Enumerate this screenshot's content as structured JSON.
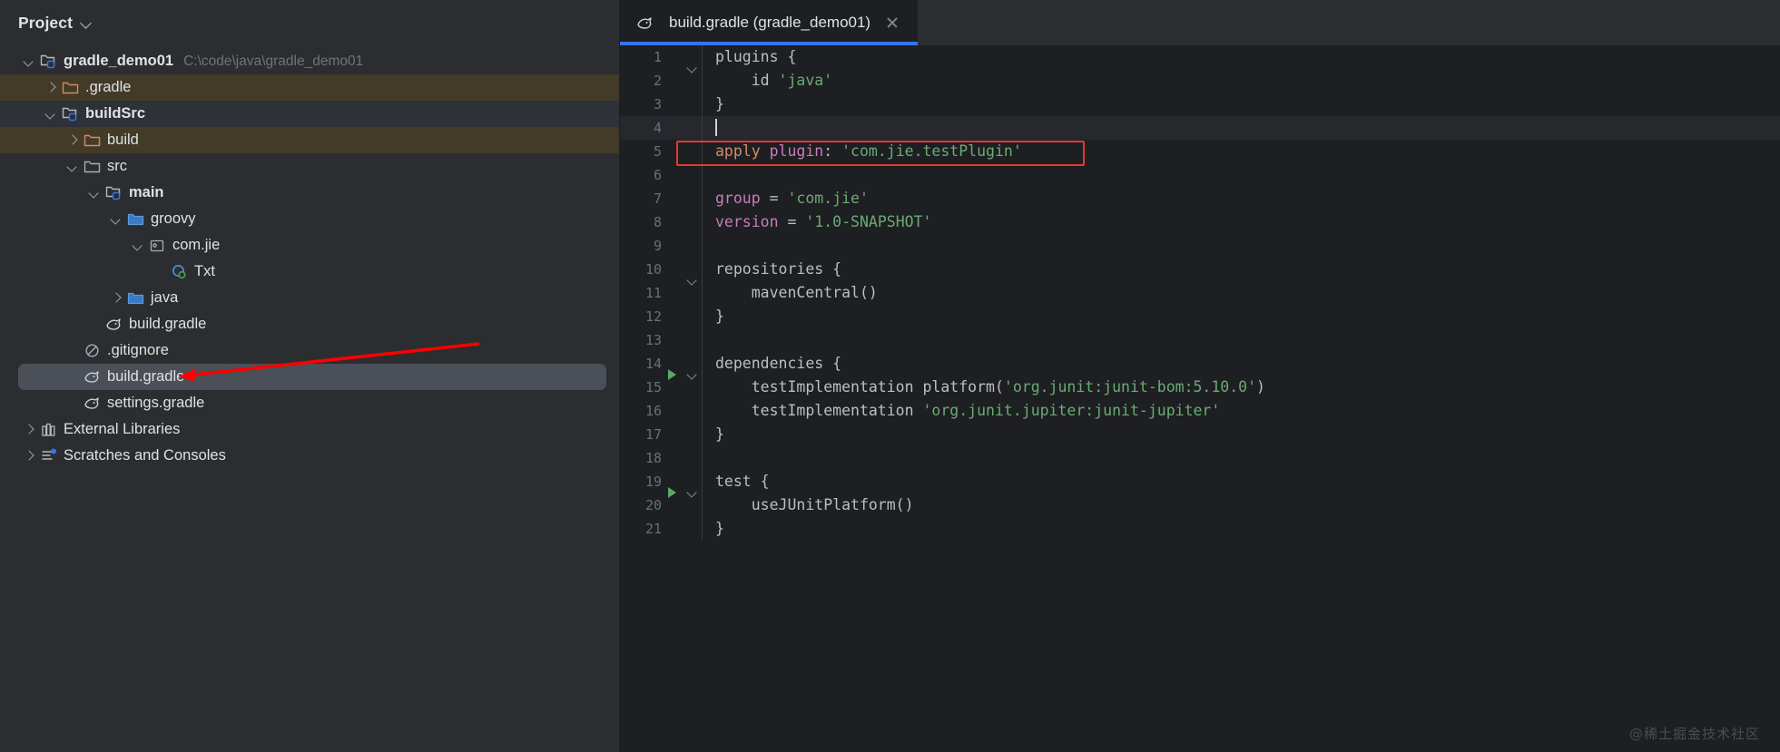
{
  "panel": {
    "title": "Project",
    "chevron_icon": "chevron-down-icon"
  },
  "tree": [
    {
      "label": "gradle_demo01",
      "sub": "C:\\code\\java\\gradle_demo01",
      "icon": "module-folder-icon",
      "twisty": "down",
      "indent": 0,
      "bold": true,
      "highlight": "none"
    },
    {
      "label": ".gradle",
      "sub": "",
      "icon": "folder-orange-icon",
      "twisty": "right",
      "indent": 1,
      "bold": false,
      "highlight": "tan"
    },
    {
      "label": "buildSrc",
      "sub": "",
      "icon": "module-folder-icon",
      "twisty": "down",
      "indent": 1,
      "bold": true,
      "highlight": "blue"
    },
    {
      "label": "build",
      "sub": "",
      "icon": "folder-orange-icon",
      "twisty": "right",
      "indent": 2,
      "bold": false,
      "highlight": "tan"
    },
    {
      "label": "src",
      "sub": "",
      "icon": "folder-gray-icon",
      "twisty": "down",
      "indent": 2,
      "bold": false,
      "highlight": "none"
    },
    {
      "label": "main",
      "sub": "",
      "icon": "module-folder-icon",
      "twisty": "down",
      "indent": 3,
      "bold": true,
      "highlight": "none"
    },
    {
      "label": "groovy",
      "sub": "",
      "icon": "folder-blue-icon",
      "twisty": "down",
      "indent": 4,
      "bold": false,
      "highlight": "none"
    },
    {
      "label": "com.jie",
      "sub": "",
      "icon": "package-icon",
      "twisty": "down",
      "indent": 5,
      "bold": false,
      "highlight": "none"
    },
    {
      "label": "Txt",
      "sub": "",
      "icon": "groovy-class-icon",
      "twisty": "none",
      "indent": 6,
      "bold": false,
      "highlight": "none"
    },
    {
      "label": "java",
      "sub": "",
      "icon": "folder-blue-icon",
      "twisty": "right",
      "indent": 4,
      "bold": false,
      "highlight": "none"
    },
    {
      "label": "build.gradle",
      "sub": "",
      "icon": "gradle-icon",
      "twisty": "none",
      "indent": 3,
      "bold": false,
      "highlight": "none"
    },
    {
      "label": ".gitignore",
      "sub": "",
      "icon": "gitignore-icon",
      "twisty": "none",
      "indent": 2,
      "bold": false,
      "highlight": "none"
    },
    {
      "label": "build.gradle",
      "sub": "",
      "icon": "gradle-icon",
      "twisty": "none",
      "indent": 2,
      "bold": false,
      "highlight": "selected"
    },
    {
      "label": "settings.gradle",
      "sub": "",
      "icon": "gradle-icon",
      "twisty": "none",
      "indent": 2,
      "bold": false,
      "highlight": "none"
    },
    {
      "label": "External Libraries",
      "sub": "",
      "icon": "libraries-icon",
      "twisty": "right",
      "indent": 0,
      "bold": false,
      "highlight": "none"
    },
    {
      "label": "Scratches and Consoles",
      "sub": "",
      "icon": "scratches-icon",
      "twisty": "right",
      "indent": 0,
      "bold": false,
      "highlight": "none"
    }
  ],
  "editor": {
    "tab": {
      "label": "build.gradle (gradle_demo01)",
      "file_icon": "gradle-icon",
      "close_icon": "close-icon"
    },
    "lines": [
      {
        "n": "1",
        "run": false,
        "fold": true,
        "current": false,
        "tokens": [
          {
            "t": "plain",
            "v": "plugins {"
          }
        ]
      },
      {
        "n": "2",
        "run": false,
        "fold": false,
        "current": false,
        "tokens": [
          {
            "t": "plain",
            "v": "    id "
          },
          {
            "t": "str",
            "v": "'java'"
          }
        ]
      },
      {
        "n": "3",
        "run": false,
        "fold": false,
        "current": false,
        "tokens": [
          {
            "t": "plain",
            "v": "}"
          }
        ]
      },
      {
        "n": "4",
        "run": false,
        "fold": false,
        "current": true,
        "tokens": [
          {
            "t": "caret",
            "v": ""
          }
        ]
      },
      {
        "n": "5",
        "run": false,
        "fold": false,
        "current": false,
        "tokens": [
          {
            "t": "kw",
            "v": "apply "
          },
          {
            "t": "pur",
            "v": "plugin"
          },
          {
            "t": "plain",
            "v": ": "
          },
          {
            "t": "str",
            "v": "'com.jie.testPlugin'"
          }
        ]
      },
      {
        "n": "6",
        "run": false,
        "fold": false,
        "current": false,
        "tokens": []
      },
      {
        "n": "7",
        "run": false,
        "fold": false,
        "current": false,
        "tokens": [
          {
            "t": "pur",
            "v": "group"
          },
          {
            "t": "plain",
            "v": " = "
          },
          {
            "t": "str",
            "v": "'com.jie'"
          }
        ]
      },
      {
        "n": "8",
        "run": false,
        "fold": false,
        "current": false,
        "tokens": [
          {
            "t": "pur",
            "v": "version"
          },
          {
            "t": "plain",
            "v": " = "
          },
          {
            "t": "str",
            "v": "'1.0-SNAPSHOT'"
          }
        ]
      },
      {
        "n": "9",
        "run": false,
        "fold": false,
        "current": false,
        "tokens": []
      },
      {
        "n": "10",
        "run": false,
        "fold": true,
        "current": false,
        "tokens": [
          {
            "t": "plain",
            "v": "repositories {"
          }
        ]
      },
      {
        "n": "11",
        "run": false,
        "fold": false,
        "current": false,
        "tokens": [
          {
            "t": "plain",
            "v": "    mavenCentral()"
          }
        ]
      },
      {
        "n": "12",
        "run": false,
        "fold": false,
        "current": false,
        "tokens": [
          {
            "t": "plain",
            "v": "}"
          }
        ]
      },
      {
        "n": "13",
        "run": false,
        "fold": false,
        "current": false,
        "tokens": []
      },
      {
        "n": "14",
        "run": true,
        "fold": true,
        "current": false,
        "tokens": [
          {
            "t": "plain",
            "v": "dependencies {"
          }
        ]
      },
      {
        "n": "15",
        "run": false,
        "fold": false,
        "current": false,
        "tokens": [
          {
            "t": "plain",
            "v": "    testImplementation platform("
          },
          {
            "t": "str",
            "v": "'org.junit:junit-bom:5.10.0'"
          },
          {
            "t": "plain",
            "v": ")"
          }
        ]
      },
      {
        "n": "16",
        "run": false,
        "fold": false,
        "current": false,
        "tokens": [
          {
            "t": "plain",
            "v": "    testImplementation "
          },
          {
            "t": "str",
            "v": "'org.junit.jupiter:junit-jupiter'"
          }
        ]
      },
      {
        "n": "17",
        "run": false,
        "fold": false,
        "current": false,
        "tokens": [
          {
            "t": "plain",
            "v": "}"
          }
        ]
      },
      {
        "n": "18",
        "run": false,
        "fold": false,
        "current": false,
        "tokens": []
      },
      {
        "n": "19",
        "run": true,
        "fold": true,
        "current": false,
        "tokens": [
          {
            "t": "plain",
            "v": "test {"
          }
        ]
      },
      {
        "n": "20",
        "run": false,
        "fold": false,
        "current": false,
        "tokens": [
          {
            "t": "plain",
            "v": "    useJUnitPlatform()"
          }
        ]
      },
      {
        "n": "21",
        "run": false,
        "fold": false,
        "current": false,
        "tokens": [
          {
            "t": "plain",
            "v": "}"
          }
        ]
      }
    ]
  },
  "annotation": {
    "red_box_line": "5",
    "arrow_color": "#ff0000",
    "box_color": "#e03b31"
  },
  "watermark": "@稀土掘金技术社区",
  "colors": {
    "panel_bg": "#2b2d30",
    "editor_bg": "#1e1f22",
    "tab_accent": "#3574f0",
    "string_green": "#6aab73",
    "keyword_orange": "#cf8e6d",
    "property_purple": "#c77dbb",
    "selection_gray": "#4b4f57",
    "highlight_tan": "#433b28"
  }
}
